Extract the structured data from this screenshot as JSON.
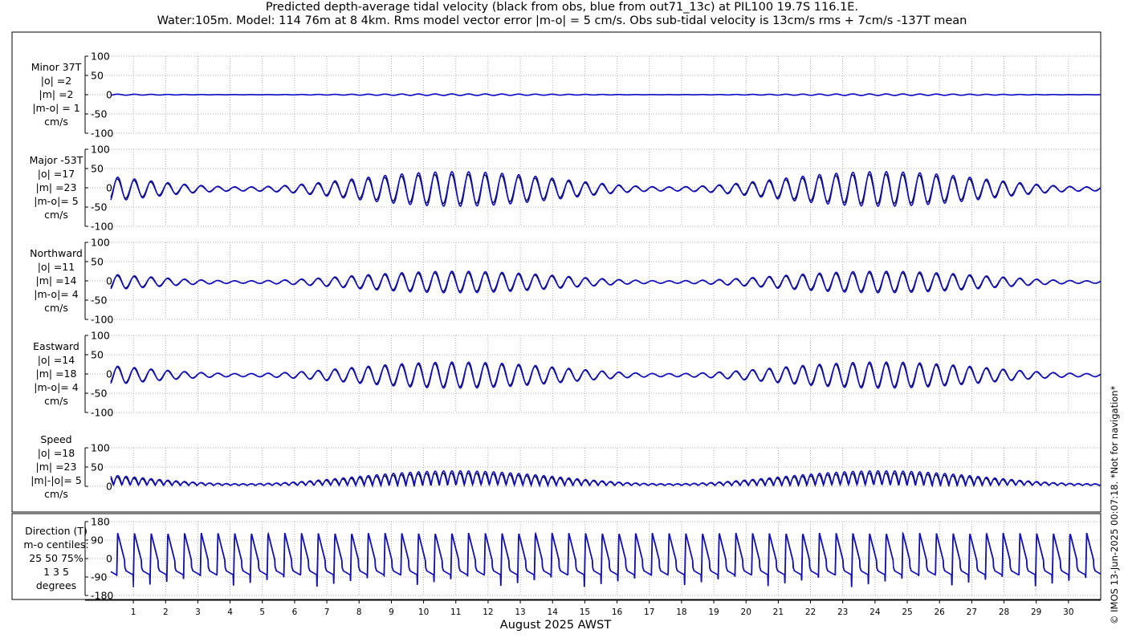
{
  "title_lines": [
    "Predicted depth-average tidal velocity (black from obs, blue from out71_13c) at PIL100 19.7S 116.1E.",
    "Water:105m. Model: 114 76m at 8 4km. Rms model vector error |m-o| = 5 cm/s. Obs sub-tidal velocity is 13cm/s rms + 7cm/s -137T mean"
  ],
  "copyright": "© IMOS 13-Jun-2025 00:07:18. *Not for navigation*",
  "colors": {
    "obs": "#000000",
    "model": "#1010cc",
    "grid": "#9a9a9a",
    "frame": "#000000"
  },
  "chart_data": {
    "type": "line",
    "xlabel": "August 2025 AWST",
    "x_ticks": [
      "1",
      "2",
      "3",
      "4",
      "5",
      "6",
      "7",
      "8",
      "9",
      "10",
      "11",
      "12",
      "13",
      "14",
      "15",
      "16",
      "17",
      "18",
      "19",
      "20",
      "21",
      "22",
      "23",
      "24",
      "25",
      "26",
      "27",
      "28",
      "29",
      "30"
    ],
    "xlim_days": [
      0.25,
      31
    ],
    "series_names": [
      "obs",
      "model"
    ],
    "grid": true,
    "panels": [
      {
        "id": "minor",
        "label_lines": [
          "Minor 37T",
          "|o| =2",
          "|m| =2",
          "|m-o| = 1",
          "cm/s"
        ],
        "ylim": [
          -100,
          100
        ],
        "yticks": [
          100,
          50,
          0,
          -50,
          -100
        ],
        "ytick_labels": [
          "100",
          "50",
          "0",
          "-50",
          "-100"
        ],
        "kind": "tidal",
        "amp_obs": 2,
        "amp_model": 2,
        "offset": 0
      },
      {
        "id": "major",
        "label_lines": [
          "Major -53T",
          "|o| =17",
          "|m| =23",
          "|m-o|= 5",
          "cm/s"
        ],
        "ylim": [
          -100,
          100
        ],
        "yticks": [
          100,
          50,
          0,
          -50,
          -100
        ],
        "ytick_labels": [
          "100",
          "50",
          "0",
          "-50",
          "-100"
        ],
        "kind": "tidal",
        "amp_obs": 38,
        "amp_model": 45,
        "offset": -3
      },
      {
        "id": "northward",
        "label_lines": [
          "Northward",
          "|o| =11",
          "|m| =14",
          "|m-o|= 4",
          "cm/s"
        ],
        "ylim": [
          -100,
          100
        ],
        "yticks": [
          100,
          50,
          0,
          -50,
          -100
        ],
        "ytick_labels": [
          "100",
          "50",
          "0",
          "-50",
          "-100"
        ],
        "kind": "tidal",
        "amp_obs": 24,
        "amp_model": 28,
        "offset": -3
      },
      {
        "id": "eastward",
        "label_lines": [
          "Eastward",
          "|o| =14",
          "|m| =18",
          "|m-o|= 4",
          "cm/s"
        ],
        "ylim": [
          -100,
          100
        ],
        "yticks": [
          100,
          50,
          0,
          -50,
          -100
        ],
        "ytick_labels": [
          "100",
          "50",
          "0",
          "-50",
          "-100"
        ],
        "kind": "tidal",
        "amp_obs": 30,
        "amp_model": 34,
        "offset": -3
      },
      {
        "id": "speed",
        "label_lines": [
          "Speed",
          "|o| =18",
          "|m| =23",
          "|m|-|o|= 5",
          "cm/s"
        ],
        "ylim": [
          0,
          100
        ],
        "yticks": [
          100,
          50,
          0
        ],
        "ytick_labels": [
          "100",
          "50",
          "0"
        ],
        "kind": "speed",
        "amp_obs": 38,
        "amp_model": 45,
        "offset": 0
      },
      {
        "id": "direction",
        "label_lines": [
          "Direction (T)",
          "m-o centiles:",
          "25  50  75%",
          "1  3  5",
          "degrees"
        ],
        "ylim": [
          -180,
          180
        ],
        "yticks": [
          180,
          90,
          0,
          -90,
          -180
        ],
        "ytick_labels": [
          "180",
          "90",
          "0",
          "-90",
          "-180"
        ],
        "kind": "direction",
        "amp_obs": 0,
        "amp_model": 0,
        "offset": 0
      }
    ]
  }
}
